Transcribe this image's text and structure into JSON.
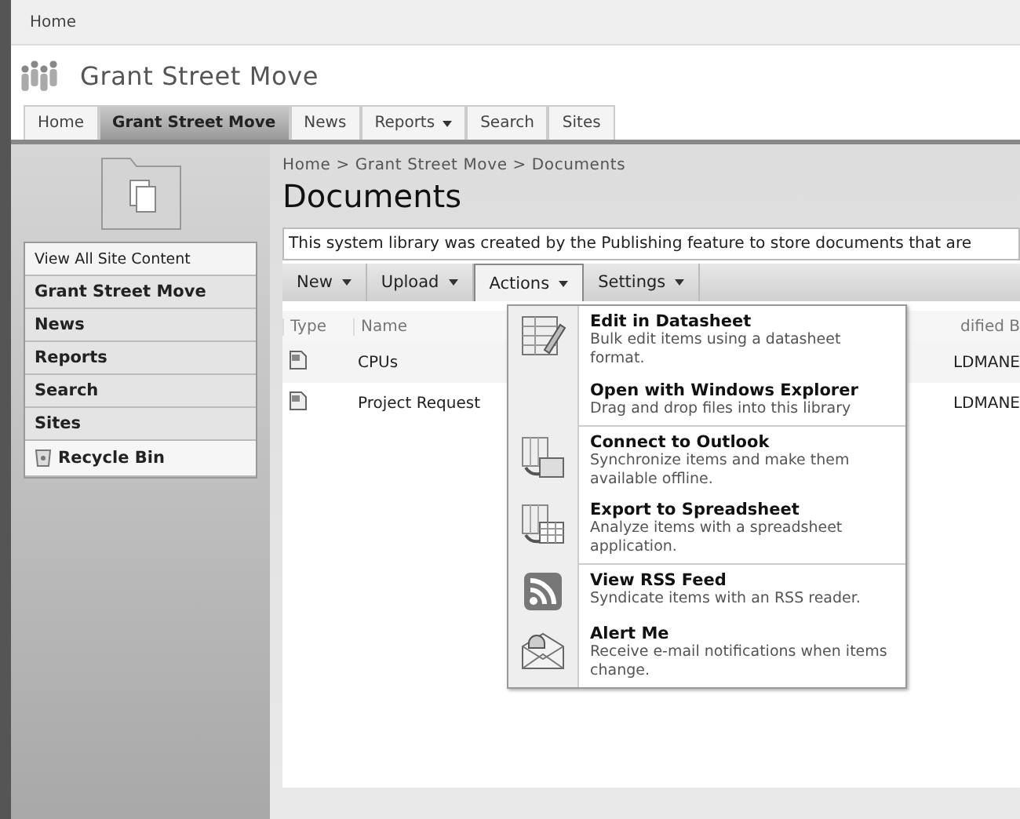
{
  "top_bar": {
    "link": "Home"
  },
  "site": {
    "title": "Grant Street Move"
  },
  "tabs": [
    {
      "label": "Home",
      "selected": false,
      "dropdown": false
    },
    {
      "label": "Grant Street Move",
      "selected": true,
      "dropdown": false
    },
    {
      "label": "News",
      "selected": false,
      "dropdown": false
    },
    {
      "label": "Reports",
      "selected": false,
      "dropdown": true
    },
    {
      "label": "Search",
      "selected": false,
      "dropdown": false
    },
    {
      "label": "Sites",
      "selected": false,
      "dropdown": false
    }
  ],
  "breadcrumb": "Home > Grant Street Move > Documents",
  "page_title": "Documents",
  "sidebar": {
    "items": [
      {
        "label": "View All Site Content",
        "kind": "link"
      },
      {
        "label": "Grant Street Move",
        "kind": "heading"
      },
      {
        "label": "News",
        "kind": "heading"
      },
      {
        "label": "Reports",
        "kind": "heading"
      },
      {
        "label": "Search",
        "kind": "heading"
      },
      {
        "label": "Sites",
        "kind": "heading"
      },
      {
        "label": "Recycle Bin",
        "kind": "recycle"
      }
    ]
  },
  "description": "This system library was created by the Publishing feature to store documents that are",
  "toolbar": [
    {
      "label": "New",
      "selected": false
    },
    {
      "label": "Upload",
      "selected": false
    },
    {
      "label": "Actions",
      "selected": true
    },
    {
      "label": "Settings",
      "selected": false
    }
  ],
  "table": {
    "columns": [
      "Type",
      "Name",
      "dified B"
    ],
    "rows": [
      {
        "name": "CPUs",
        "column_3": "LDMANE"
      },
      {
        "name": "Project Request",
        "column_3": "LDMANE"
      }
    ]
  },
  "menu": {
    "groups": [
      [
        {
          "kind": "datasheet",
          "title": "Edit in Datasheet",
          "description": "Bulk edit items using a datasheet format."
        },
        {
          "kind": "none",
          "title": "Open with Windows Explorer",
          "description": "Drag and drop files into this library"
        }
      ],
      [
        {
          "kind": "outlook",
          "title": "Connect to Outlook",
          "description": "Synchronize items and make them available offline."
        },
        {
          "kind": "spreadsheet",
          "title": "Export to Spreadsheet",
          "description": "Analyze items with a spreadsheet application."
        }
      ],
      [
        {
          "kind": "rss",
          "title": "View RSS Feed",
          "description": "Syndicate items with an RSS reader."
        },
        {
          "kind": "alert",
          "title": "Alert Me",
          "description": "Receive e-mail notifications when items change."
        }
      ]
    ]
  }
}
